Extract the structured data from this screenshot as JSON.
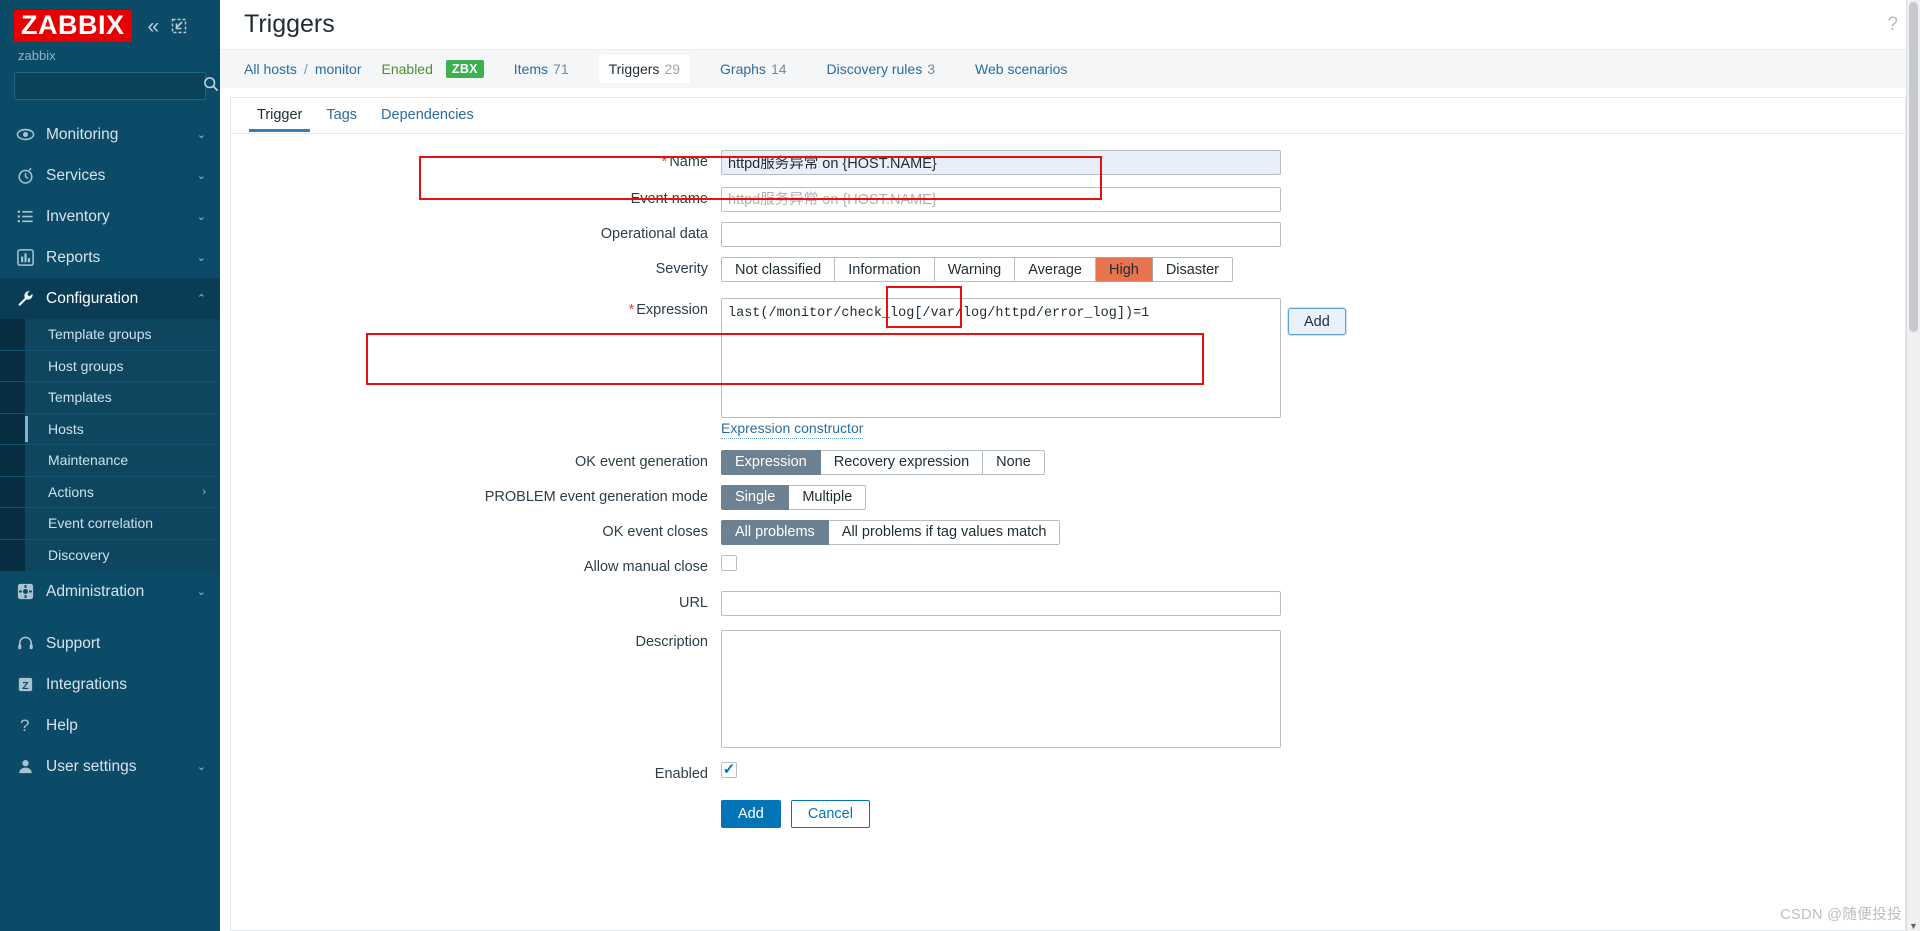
{
  "sidebar": {
    "logo": "ZABBIX",
    "server_name": "zabbix",
    "collapse_icon": "«",
    "expand_icon": "expand-panel-icon",
    "search": {
      "value": "",
      "placeholder": ""
    },
    "nav": [
      {
        "label": "Monitoring",
        "icon": "eye-icon",
        "chevron": "⌄",
        "active": false
      },
      {
        "label": "Services",
        "icon": "stopwatch-icon",
        "chevron": "⌄",
        "active": false
      },
      {
        "label": "Inventory",
        "icon": "list-icon",
        "chevron": "⌄",
        "active": false
      },
      {
        "label": "Reports",
        "icon": "bar-chart-icon",
        "chevron": "⌄",
        "active": false
      },
      {
        "label": "Configuration",
        "icon": "wrench-icon",
        "chevron": "⌃",
        "active": true
      }
    ],
    "subnav": [
      {
        "label": "Template groups",
        "selected": false,
        "chevron": ""
      },
      {
        "label": "Host groups",
        "selected": false,
        "chevron": ""
      },
      {
        "label": "Templates",
        "selected": false,
        "chevron": ""
      },
      {
        "label": "Hosts",
        "selected": true,
        "chevron": ""
      },
      {
        "label": "Maintenance",
        "selected": false,
        "chevron": ""
      },
      {
        "label": "Actions",
        "selected": false,
        "chevron": "›"
      },
      {
        "label": "Event correlation",
        "selected": false,
        "chevron": ""
      },
      {
        "label": "Discovery",
        "selected": false,
        "chevron": ""
      }
    ],
    "nav_bottom": [
      {
        "label": "Administration",
        "icon": "cog-icon",
        "chevron": "⌄"
      },
      {
        "label": "Support",
        "icon": "headset-icon",
        "chevron": ""
      },
      {
        "label": "Integrations",
        "icon": "z-square-icon",
        "chevron": ""
      },
      {
        "label": "Help",
        "icon": "question-icon",
        "chevron": ""
      },
      {
        "label": "User settings",
        "icon": "user-icon",
        "chevron": "⌄"
      }
    ]
  },
  "header": {
    "title": "Triggers",
    "help_icon": "?"
  },
  "breadcrumb": {
    "all_hosts": "All hosts",
    "separator": "/",
    "host": "monitor",
    "status": "Enabled",
    "agent_badge": "ZBX",
    "tabs": [
      {
        "label": "Items",
        "count": "71",
        "active": false
      },
      {
        "label": "Triggers",
        "count": "29",
        "active": true
      },
      {
        "label": "Graphs",
        "count": "14",
        "active": false
      },
      {
        "label": "Discovery rules",
        "count": "3",
        "active": false
      },
      {
        "label": "Web scenarios",
        "count": "",
        "active": false
      }
    ]
  },
  "form": {
    "tabs": [
      {
        "label": "Trigger",
        "active": true
      },
      {
        "label": "Tags",
        "active": false
      },
      {
        "label": "Dependencies",
        "active": false
      }
    ],
    "name": {
      "label": "Name",
      "required": "*",
      "value": "httpd服务异常 on {HOST.NAME}",
      "placeholder": ""
    },
    "event_name": {
      "label": "Event name",
      "value": "",
      "placeholder": "httpd服务异常 on {HOST.NAME}"
    },
    "operational_data": {
      "label": "Operational data",
      "value": "",
      "placeholder": ""
    },
    "severity": {
      "label": "Severity",
      "options": [
        "Not classified",
        "Information",
        "Warning",
        "Average",
        "High",
        "Disaster"
      ],
      "selected": "High"
    },
    "expression": {
      "label": "Expression",
      "required": "*",
      "value": "last(/monitor/check_log[/var/log/httpd/error_log])=1",
      "add_button": "Add",
      "constructor_link": "Expression constructor"
    },
    "ok_event_generation": {
      "label": "OK event generation",
      "options": [
        "Expression",
        "Recovery expression",
        "None"
      ],
      "selected": "Expression"
    },
    "problem_event_generation_mode": {
      "label": "PROBLEM event generation mode",
      "options": [
        "Single",
        "Multiple"
      ],
      "selected": "Single"
    },
    "ok_event_closes": {
      "label": "OK event closes",
      "options": [
        "All problems",
        "All problems if tag values match"
      ],
      "selected": "All problems"
    },
    "allow_manual_close": {
      "label": "Allow manual close",
      "checked": false
    },
    "url": {
      "label": "URL",
      "value": "",
      "placeholder": ""
    },
    "description": {
      "label": "Description",
      "value": "",
      "placeholder": ""
    },
    "enabled": {
      "label": "Enabled",
      "checked": true,
      "tick": "✓"
    },
    "footer": {
      "submit": "Add",
      "cancel": "Cancel"
    }
  },
  "watermark": "CSDN @随便投投",
  "colors": {
    "sidebar_bg": "#0c4b68",
    "logo_red": "#e60000",
    "accent_blue": "#0275b8",
    "link_blue": "#2a6ca3",
    "agent_green": "#3db04f",
    "severity_high": "#e8744f",
    "segment_selected": "#6c8293",
    "highlight_red": "#e8100f"
  }
}
